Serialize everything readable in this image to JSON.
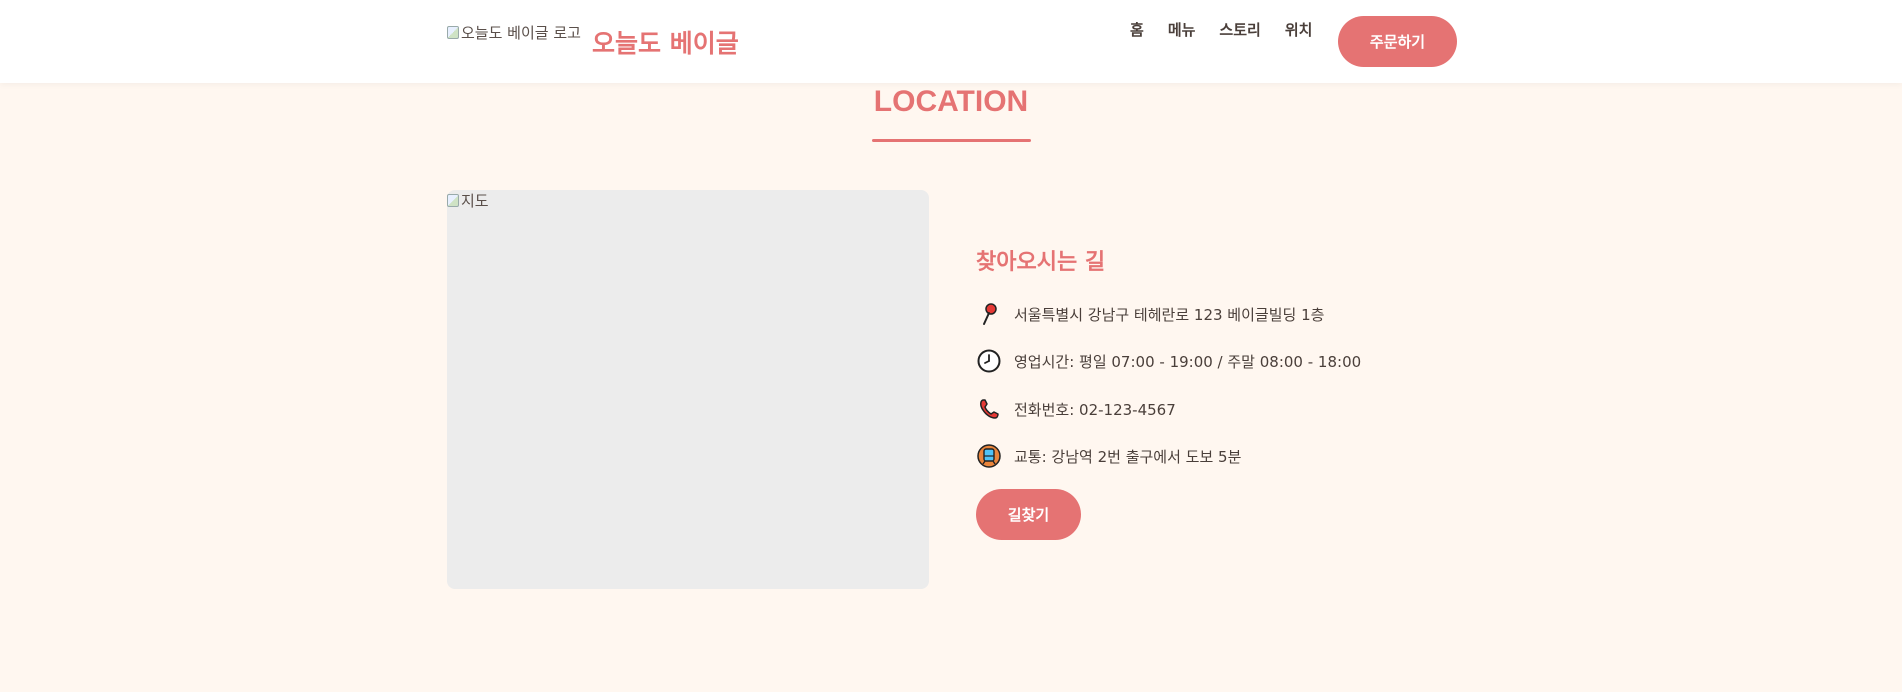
{
  "header": {
    "logo_alt": "오늘도 베이글 로고",
    "brand": "오늘도 베이글",
    "nav": [
      "홈",
      "메뉴",
      "스토리",
      "위치"
    ],
    "order_label": "주문하기"
  },
  "section": {
    "title": "LOCATION"
  },
  "map": {
    "alt": "지도"
  },
  "info": {
    "title": "찾아오시는 길",
    "address": "서울특별시 강남구 테헤란로 123 베이글빌딩 1층",
    "hours": "영업시간: 평일 07:00 - 19:00 / 주말 08:00 - 18:00",
    "phone": "전화번호: 02-123-4567",
    "transit": "교통: 강남역 2번 출구에서 도보 5분",
    "directions_label": "길찾기"
  },
  "icons": {
    "address": "pushpin-icon",
    "hours": "clock-icon",
    "phone": "telephone-icon",
    "transit": "train-icon"
  },
  "colors": {
    "accent": "#e57373",
    "background": "#fff7f0",
    "map_placeholder": "#ececec"
  }
}
